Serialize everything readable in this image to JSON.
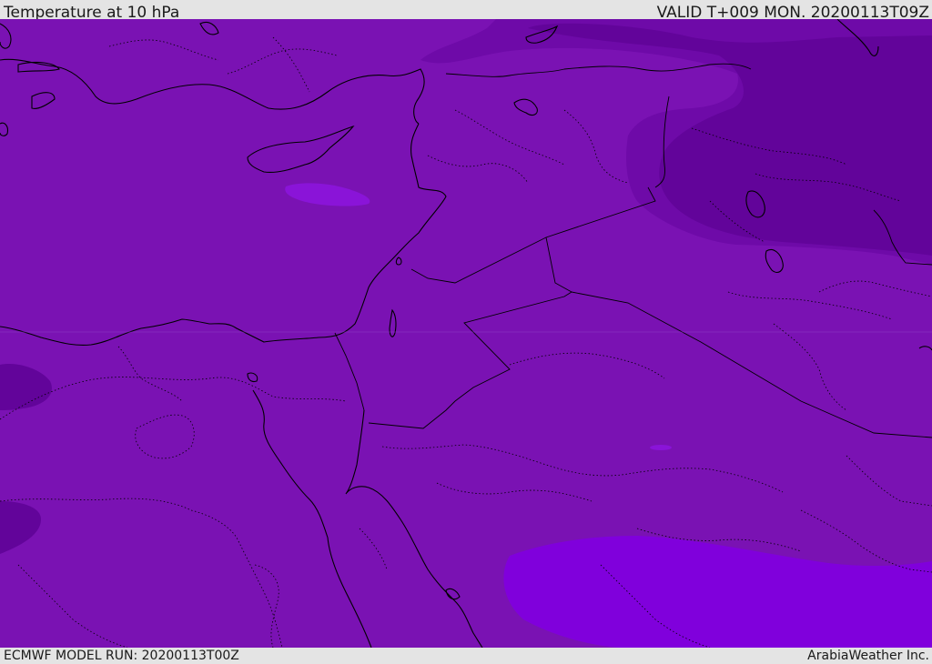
{
  "header": {
    "title": "Temperature at 10 hPa",
    "valid": "VALID T+009 MON. 20200113T09Z"
  },
  "footer": {
    "model_run": "ECMWF MODEL RUN: 20200113T00Z",
    "credit": "ArabiaWeather Inc."
  },
  "map": {
    "field": "temperature",
    "pressure_level": "10 hPa",
    "colors": {
      "base": "#7a12b3",
      "cold_zone": "#62049a",
      "cold_zone_mid": "#6e0aa8",
      "warm_zone": "#8000dc",
      "warm_zone_small": "#8a14d8",
      "boundary": "#000000"
    }
  }
}
